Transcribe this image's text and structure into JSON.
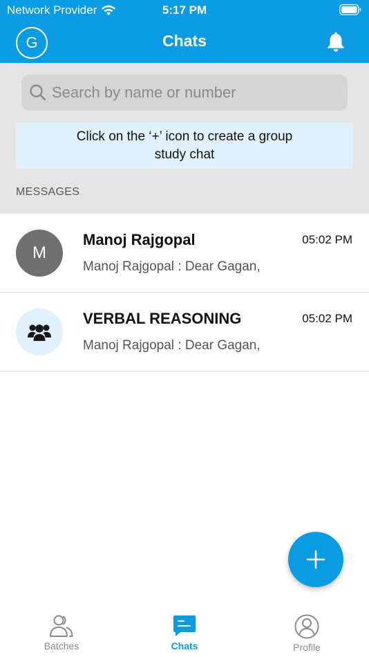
{
  "status_bar": {
    "carrier": "Network Provider",
    "time": "5:17 PM"
  },
  "header": {
    "avatar_initial": "G",
    "title": "Chats"
  },
  "search": {
    "placeholder": "Search by name or number",
    "value": ""
  },
  "hint": {
    "text": "Click on the ‘+’ icon to create a group study chat"
  },
  "section": {
    "label": "MESSAGES"
  },
  "chats": [
    {
      "avatar_type": "initial",
      "avatar_initial": "M",
      "name": "Manoj Rajgopal",
      "time": "05:02 PM",
      "preview": "Manoj Rajgopal : Dear Gagan,"
    },
    {
      "avatar_type": "group-icon",
      "name": "VERBAL REASONING",
      "time": "05:02 PM",
      "preview": "Manoj Rajgopal : Dear Gagan,"
    }
  ],
  "fab": {
    "icon": "plus-icon"
  },
  "tabbar": {
    "tabs": [
      {
        "label": "Batches",
        "icon": "users-icon",
        "active": false
      },
      {
        "label": "Chats",
        "icon": "chat-icon",
        "active": true
      },
      {
        "label": "Profile",
        "icon": "profile-icon",
        "active": false
      }
    ]
  },
  "colors": {
    "primary": "#0a9be2",
    "band": "#e5e5e5",
    "hint_bg": "#e1f1fb",
    "avatar_grey": "#707070"
  }
}
